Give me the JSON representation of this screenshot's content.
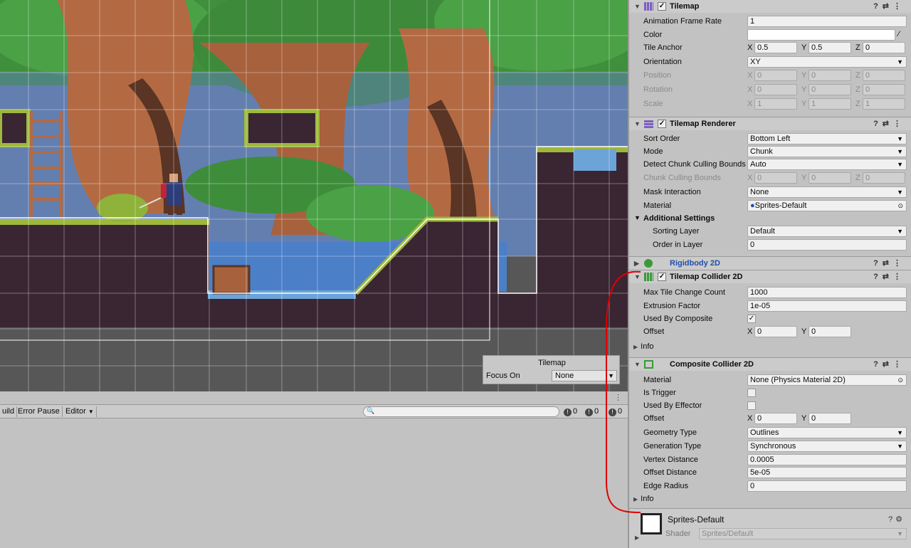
{
  "scene": {
    "overlay_title": "Tilemap",
    "overlay_focus_label": "Focus On",
    "overlay_focus_value": "None"
  },
  "console": {
    "build_label": "uild",
    "error_pause_label": "Error Pause",
    "editor_label": "Editor",
    "log_count": "0",
    "warn_count": "0",
    "error_count": "0"
  },
  "inspector": {
    "tilemap": {
      "title": "Tilemap",
      "animation_frame_rate_label": "Animation Frame Rate",
      "animation_frame_rate": "1",
      "color_label": "Color",
      "tile_anchor_label": "Tile Anchor",
      "tile_anchor": {
        "x": "0.5",
        "y": "0.5",
        "z": "0"
      },
      "orientation_label": "Orientation",
      "orientation": "XY",
      "position_label": "Position",
      "position": {
        "x": "0",
        "y": "0",
        "z": "0"
      },
      "rotation_label": "Rotation",
      "rotation": {
        "x": "0",
        "y": "0",
        "z": "0"
      },
      "scale_label": "Scale",
      "scale": {
        "x": "1",
        "y": "1",
        "z": "1"
      }
    },
    "renderer": {
      "title": "Tilemap Renderer",
      "sort_order_label": "Sort Order",
      "sort_order": "Bottom Left",
      "mode_label": "Mode",
      "mode": "Chunk",
      "culling_label": "Detect Chunk Culling Bounds",
      "culling": "Auto",
      "culling_bounds_label": "Chunk Culling Bounds",
      "culling_bounds": {
        "x": "0",
        "y": "0",
        "z": "0"
      },
      "mask_label": "Mask Interaction",
      "mask": "None",
      "material_label": "Material",
      "material": "Sprites-Default",
      "additional_label": "Additional Settings",
      "sorting_layer_label": "Sorting Layer",
      "sorting_layer": "Default",
      "order_label": "Order in Layer",
      "order": "0"
    },
    "rigidbody": {
      "title": "Rigidbody 2D"
    },
    "tile_collider": {
      "title": "Tilemap Collider 2D",
      "max_label": "Max Tile Change Count",
      "max": "1000",
      "extrusion_label": "Extrusion Factor",
      "extrusion": "1e-05",
      "composite_label": "Used By Composite",
      "offset_label": "Offset",
      "offset": {
        "x": "0",
        "y": "0"
      },
      "info_label": "Info"
    },
    "composite": {
      "title": "Composite Collider 2D",
      "material_label": "Material",
      "material": "None (Physics Material 2D)",
      "trigger_label": "Is Trigger",
      "effector_label": "Used By Effector",
      "offset_label": "Offset",
      "offset": {
        "x": "0",
        "y": "0"
      },
      "geometry_label": "Geometry Type",
      "geometry": "Outlines",
      "generation_label": "Generation Type",
      "generation": "Synchronous",
      "vertex_label": "Vertex Distance",
      "vertex": "0.0005",
      "offset_distance_label": "Offset Distance",
      "offset_distance": "5e-05",
      "edge_label": "Edge Radius",
      "edge": "0",
      "info_label": "Info"
    },
    "material_preview": {
      "name": "Sprites-Default",
      "shader_label": "Shader",
      "shader": "Sprites/Default"
    }
  },
  "colors": {
    "accent_red": "#e00000",
    "link_blue": "#1f4fa8"
  }
}
